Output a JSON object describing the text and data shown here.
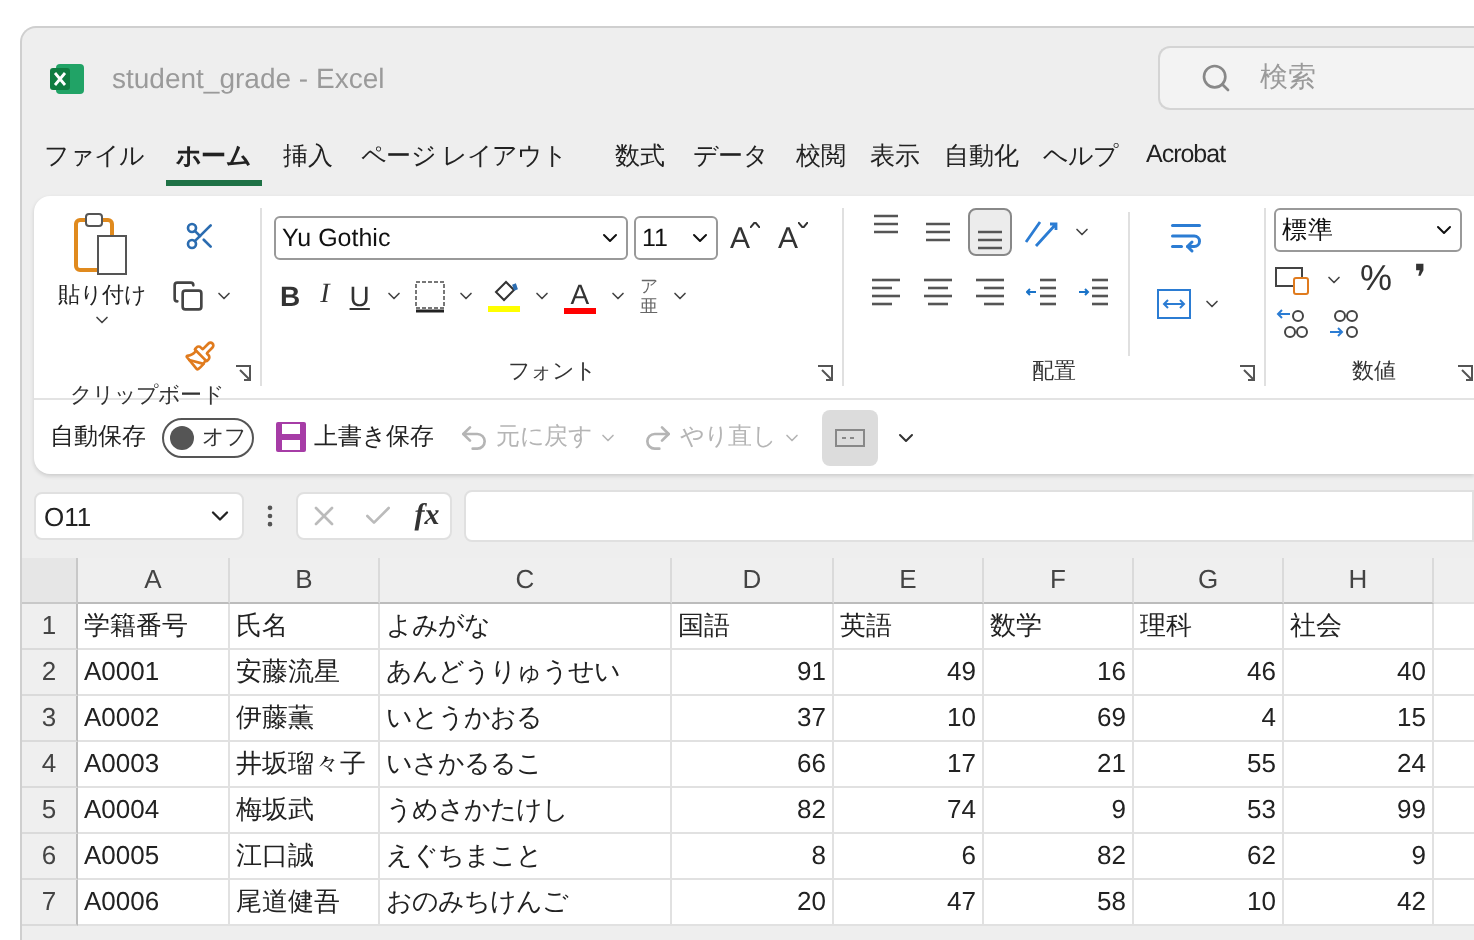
{
  "window": {
    "title": "student_grade",
    "app": "Excel",
    "separator": "-",
    "search_placeholder": "検索"
  },
  "menu_tabs": [
    {
      "label": "ファイル",
      "selected": false
    },
    {
      "label": "ホーム",
      "selected": true
    },
    {
      "label": "挿入",
      "selected": false
    },
    {
      "label": "ページ レイアウト",
      "selected": false
    },
    {
      "label": "数式",
      "selected": false
    },
    {
      "label": "データ",
      "selected": false
    },
    {
      "label": "校閲",
      "selected": false
    },
    {
      "label": "表示",
      "selected": false
    },
    {
      "label": "自動化",
      "selected": false
    },
    {
      "label": "ヘルプ",
      "selected": false
    },
    {
      "label": "Acrobat",
      "selected": false
    }
  ],
  "ribbon": {
    "clipboard": {
      "paste_label": "貼り付け",
      "group_label": "クリップボード"
    },
    "font": {
      "font_name": "Yu Gothic",
      "font_size": "11",
      "grow_glyph": "A",
      "shrink_glyph": "A",
      "bold": "B",
      "italic": "I",
      "underline": "U",
      "font_color_glyph": "A",
      "phonetic_top": "ア",
      "phonetic_bottom": "亜",
      "group_label": "フォント"
    },
    "alignment": {
      "vertical": [
        {
          "kind": "top",
          "selected": false
        },
        {
          "kind": "middle",
          "selected": false
        },
        {
          "kind": "bottom",
          "selected": true
        }
      ],
      "horizontal": [
        {
          "kind": "left"
        },
        {
          "kind": "center"
        },
        {
          "kind": "right"
        },
        {
          "kind": "outdent"
        },
        {
          "kind": "indent"
        }
      ],
      "group_label": "配置"
    },
    "number": {
      "format": "標準",
      "percent": "%",
      "comma": "❜",
      "group_label": "数値"
    }
  },
  "quick_access": {
    "autosave_label": "自動保存",
    "autosave": {
      "label": "オフ",
      "on": false
    },
    "save": "上書き保存",
    "undo": {
      "label": "元に戻す",
      "disabled": true
    },
    "redo": {
      "label": "やり直し",
      "disabled": true
    }
  },
  "formula_bar": {
    "name_box": "O11",
    "fx": "fx"
  },
  "sheet": {
    "columns": [
      "A",
      "B",
      "C",
      "D",
      "E",
      "F",
      "G",
      "H"
    ],
    "rows": [
      {
        "number": "1",
        "cells": [
          "学籍番号",
          "氏名",
          "よみがな",
          "国語",
          "英語",
          "数学",
          "理科",
          "社会"
        ]
      },
      {
        "number": "2",
        "cells": [
          "A0001",
          "安藤流星",
          "あんどうりゅうせい",
          "91",
          "49",
          "16",
          "46",
          "40"
        ]
      },
      {
        "number": "3",
        "cells": [
          "A0002",
          "伊藤薫",
          "いとうかおる",
          "37",
          "10",
          "69",
          "4",
          "15"
        ]
      },
      {
        "number": "4",
        "cells": [
          "A0003",
          "井坂瑠々子",
          "いさかるるこ",
          "66",
          "17",
          "21",
          "55",
          "24"
        ]
      },
      {
        "number": "5",
        "cells": [
          "A0004",
          "梅坂武",
          "うめさかたけし",
          "82",
          "74",
          "9",
          "53",
          "99"
        ]
      },
      {
        "number": "6",
        "cells": [
          "A0005",
          "江口誠",
          "えぐちまこと",
          "8",
          "6",
          "82",
          "62",
          "9"
        ]
      },
      {
        "number": "7",
        "cells": [
          "A0006",
          "尾道健吾",
          "おのみちけんご",
          "20",
          "47",
          "58",
          "10",
          "42"
        ]
      }
    ]
  }
}
